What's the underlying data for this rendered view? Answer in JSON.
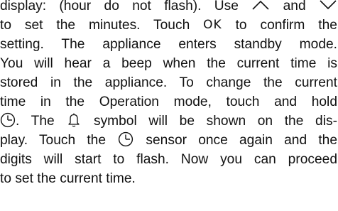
{
  "paragraph": {
    "line1": "display: (hour do not flash). Use",
    "line1_and": "and",
    "line2": "to set the minutes. Touch",
    "line2_ok": "OK",
    "line2_end": "to confirm the",
    "line3": "setting. The appliance enters standby mode.",
    "line4": "You will hear a beep when the current time is",
    "line5": "stored in the appliance. To change the current",
    "line6": "time in the Operation mode, touch and hold",
    "line7_a": ". The",
    "line7_b": "symbol will be shown on the dis-",
    "line8_a": "play. Touch the",
    "line8_b": "sensor once again and the",
    "line9": "digits will start to flash. Now you can proceed",
    "line10": "to set the current time."
  },
  "icons": {
    "up": "chevron-up-icon",
    "down": "chevron-down-icon",
    "clock": "clock-icon",
    "bell": "bell-icon"
  },
  "colors": {
    "text": "#111111",
    "background": "#ffffff"
  }
}
